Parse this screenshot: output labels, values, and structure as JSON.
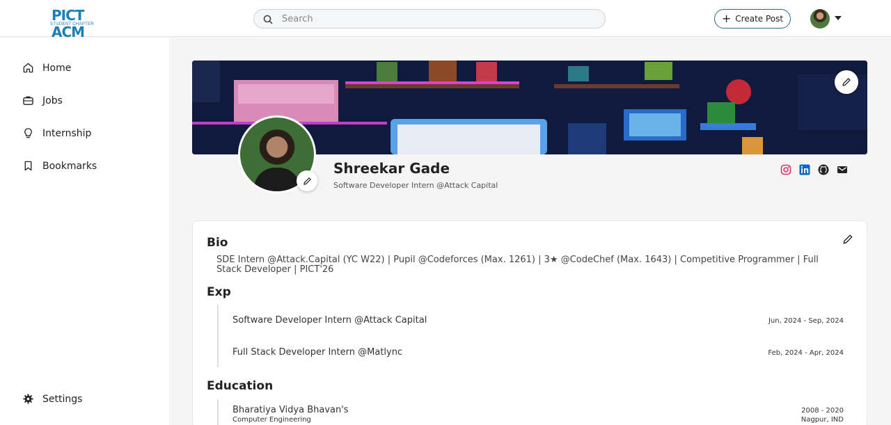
{
  "header": {
    "logo_text": "PICT ACM",
    "logo_sub": "STUDENT CHAPTER",
    "search_placeholder": "Search",
    "create_post_label": "Create Post"
  },
  "sidebar": {
    "items": [
      {
        "label": "Home",
        "icon": "home-icon"
      },
      {
        "label": "Jobs",
        "icon": "briefcase-icon"
      },
      {
        "label": "Internship",
        "icon": "lightbulb-icon"
      },
      {
        "label": "Bookmarks",
        "icon": "bookmark-icon"
      }
    ],
    "settings_label": "Settings"
  },
  "profile": {
    "name": "Shreekar Gade",
    "headline": "Software Developer Intern @Attack Capital",
    "socials": [
      "instagram-icon",
      "linkedin-icon",
      "github-icon",
      "mail-icon"
    ]
  },
  "bio": {
    "title": "Bio",
    "text": "SDE Intern @Attack.Capital (YC W22) | Pupil @Codeforces (Max. 1261) | 3★ @CodeChef (Max. 1643) | Competitive Programmer | Full Stack Developer | PICT'26"
  },
  "experience": {
    "title": "Exp",
    "items": [
      {
        "role": "Software Developer Intern @Attack Capital",
        "dates": "Jun, 2024 - Sep, 2024"
      },
      {
        "role": "Full Stack Developer Intern @Matlync",
        "dates": "Feb, 2024 - Apr, 2024"
      }
    ]
  },
  "education": {
    "title": "Education",
    "items": [
      {
        "school": "Bharatiya Vidya Bhavan's",
        "field": "Computer Engineering",
        "dates": "2008 - 2020",
        "location": "Nagpur, IND"
      }
    ]
  },
  "colors": {
    "accent": "#2b6a8a",
    "instagram": "#e1306c",
    "linkedin": "#0a66c2"
  }
}
